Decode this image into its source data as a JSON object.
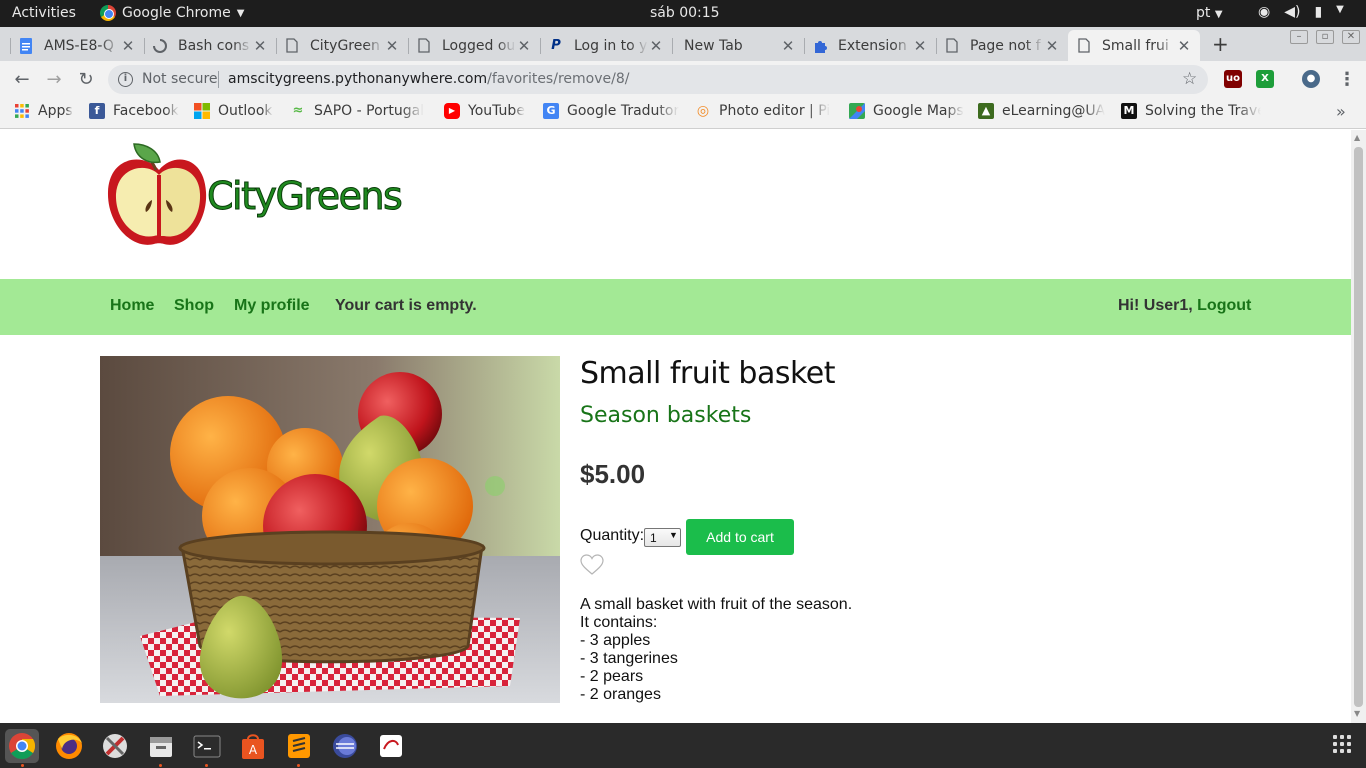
{
  "system": {
    "activities": "Activities",
    "app_name": "Google Chrome",
    "clock": "sáb 00:15",
    "lang": "pt"
  },
  "tabs": [
    {
      "title": "AMS-E8-Q",
      "icon": "docs-icon",
      "color": "#4285f4"
    },
    {
      "title": "Bash cons",
      "icon": "loading-icon",
      "color": "#5f6368"
    },
    {
      "title": "CityGreen",
      "icon": "page-icon",
      "color": "#5f6368"
    },
    {
      "title": "Logged ou",
      "icon": "page-icon",
      "color": "#5f6368"
    },
    {
      "title": "Log in to y",
      "icon": "paypal-icon",
      "color": "#003087"
    },
    {
      "title": "New Tab",
      "icon": "",
      "color": ""
    },
    {
      "title": "Extension",
      "icon": "puzzle-icon",
      "color": "#3367d6"
    },
    {
      "title": "Page not f",
      "icon": "page-icon",
      "color": "#5f6368"
    },
    {
      "title": "Small frui",
      "icon": "page-icon",
      "color": "#5f6368"
    }
  ],
  "omnibox": {
    "security": "Not secure",
    "host": "amscitygreens.pythonanywhere.com",
    "path": "/favorites/remove/8/"
  },
  "bookmarks": [
    {
      "label": "Apps",
      "icon": "apps-grid-icon",
      "color": "#e94235"
    },
    {
      "label": "Facebook",
      "icon": "facebook-icon",
      "color": "#3b5998"
    },
    {
      "label": "Outlook",
      "icon": "outlook-icon",
      "color": "#f25022"
    },
    {
      "label": "SAPO - Portugal",
      "icon": "sapo-icon",
      "color": "#58b947"
    },
    {
      "label": "YouTube",
      "icon": "youtube-icon",
      "color": "#ff0000"
    },
    {
      "label": "Google Tradutor",
      "icon": "translate-icon",
      "color": "#4285f4"
    },
    {
      "label": "Photo editor | Pi",
      "icon": "pixlr-icon",
      "color": "#f28c28"
    },
    {
      "label": "Google Maps",
      "icon": "maps-icon",
      "color": "#34a853"
    },
    {
      "label": "eLearning@UA",
      "icon": "elearning-icon",
      "color": "#3d6b1f"
    },
    {
      "label": "Solving the Trave",
      "icon": "medium-icon",
      "color": "#111111"
    }
  ],
  "site": {
    "logo_text": "CityGreens",
    "nav": {
      "home": "Home",
      "shop": "Shop",
      "profile": "My profile",
      "cart": "Your cart is empty.",
      "greeting": "Hi! User1,",
      "logout": "Logout"
    }
  },
  "product": {
    "title": "Small fruit basket",
    "category": "Season baskets",
    "price": "$5.00",
    "quantity_label": "Quantity:",
    "quantity_value": "1",
    "add_to_cart": "Add to cart",
    "description": [
      "A small basket with fruit of the season.",
      "It contains:",
      "- 3 apples",
      "- 3 tangerines",
      "- 2 pears",
      "- 2 oranges"
    ]
  },
  "colors": {
    "nav_bg": "#a3e995",
    "link_green": "#187418",
    "button_green": "#1bbd4b"
  }
}
